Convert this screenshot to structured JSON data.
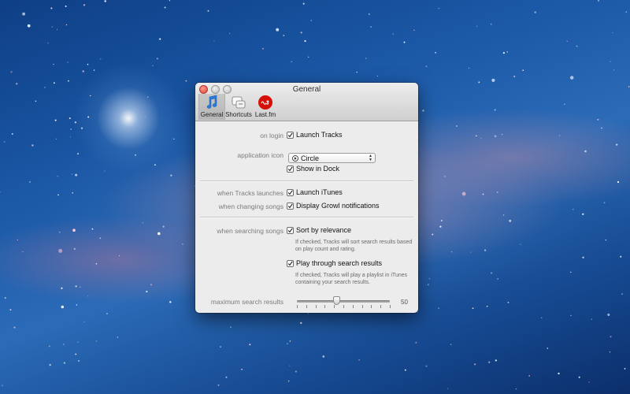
{
  "window": {
    "title": "General",
    "tabs": [
      {
        "label": "General",
        "icon": "music-note-icon",
        "selected": true
      },
      {
        "label": "Shortcuts",
        "icon": "keyboard-shortcuts-icon",
        "selected": false
      },
      {
        "label": "Last.fm",
        "icon": "lastfm-icon",
        "selected": false
      }
    ]
  },
  "settings": {
    "on_login_label": "on login",
    "launch_tracks": {
      "label": "Launch Tracks",
      "checked": true
    },
    "app_icon_label": "application icon",
    "app_icon_value": "Circle",
    "show_in_dock": {
      "label": "Show in Dock",
      "checked": true
    },
    "when_tracks_launches_label": "when Tracks launches",
    "launch_itunes": {
      "label": "Launch iTunes",
      "checked": true
    },
    "when_changing_songs_label": "when changing songs",
    "growl": {
      "label": "Display Growl notifications",
      "checked": true
    },
    "when_searching_label": "when searching songs",
    "sort_relevance": {
      "label": "Sort by relevance",
      "checked": true
    },
    "sort_help": "If checked, Tracks will sort search results based on play count and rating.",
    "play_through": {
      "label": "Play through search results",
      "checked": true
    },
    "play_help": "If checked, Tracks will play a playlist in iTunes containing your search results.",
    "max_results_label": "maximum search results",
    "max_results_value": "50",
    "max_results_fraction": 0.43,
    "slider_ticks": 11
  },
  "colors": {
    "accent_blue": "#2a7ad8",
    "lastfm_red": "#d51007"
  }
}
